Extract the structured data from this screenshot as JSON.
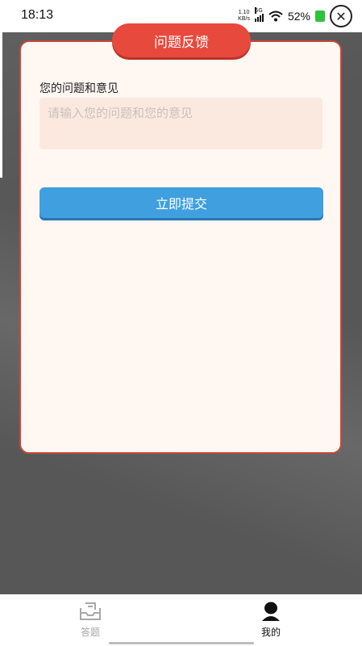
{
  "status_bar": {
    "time": "18:13",
    "net_speed_value": "1.10",
    "net_speed_unit": "KB/s",
    "network_type": "5G",
    "battery_percent": "52%"
  },
  "dialog": {
    "title": "问题反馈",
    "field_label": "您的问题和意见",
    "textarea_placeholder": "请输入您的问题和您的意见",
    "submit_label": "立即提交"
  },
  "tabbar": {
    "items": [
      {
        "label": "答题",
        "icon": "inbox-tray-icon",
        "active": false
      },
      {
        "label": "我的",
        "icon": "user-icon",
        "active": true
      }
    ]
  },
  "colors": {
    "title_pill": "#e8493d",
    "submit_button": "#3f9fdf",
    "card_background": "#fff7f2",
    "card_border": "#c9463c",
    "textarea_background": "#fbe9e0"
  }
}
